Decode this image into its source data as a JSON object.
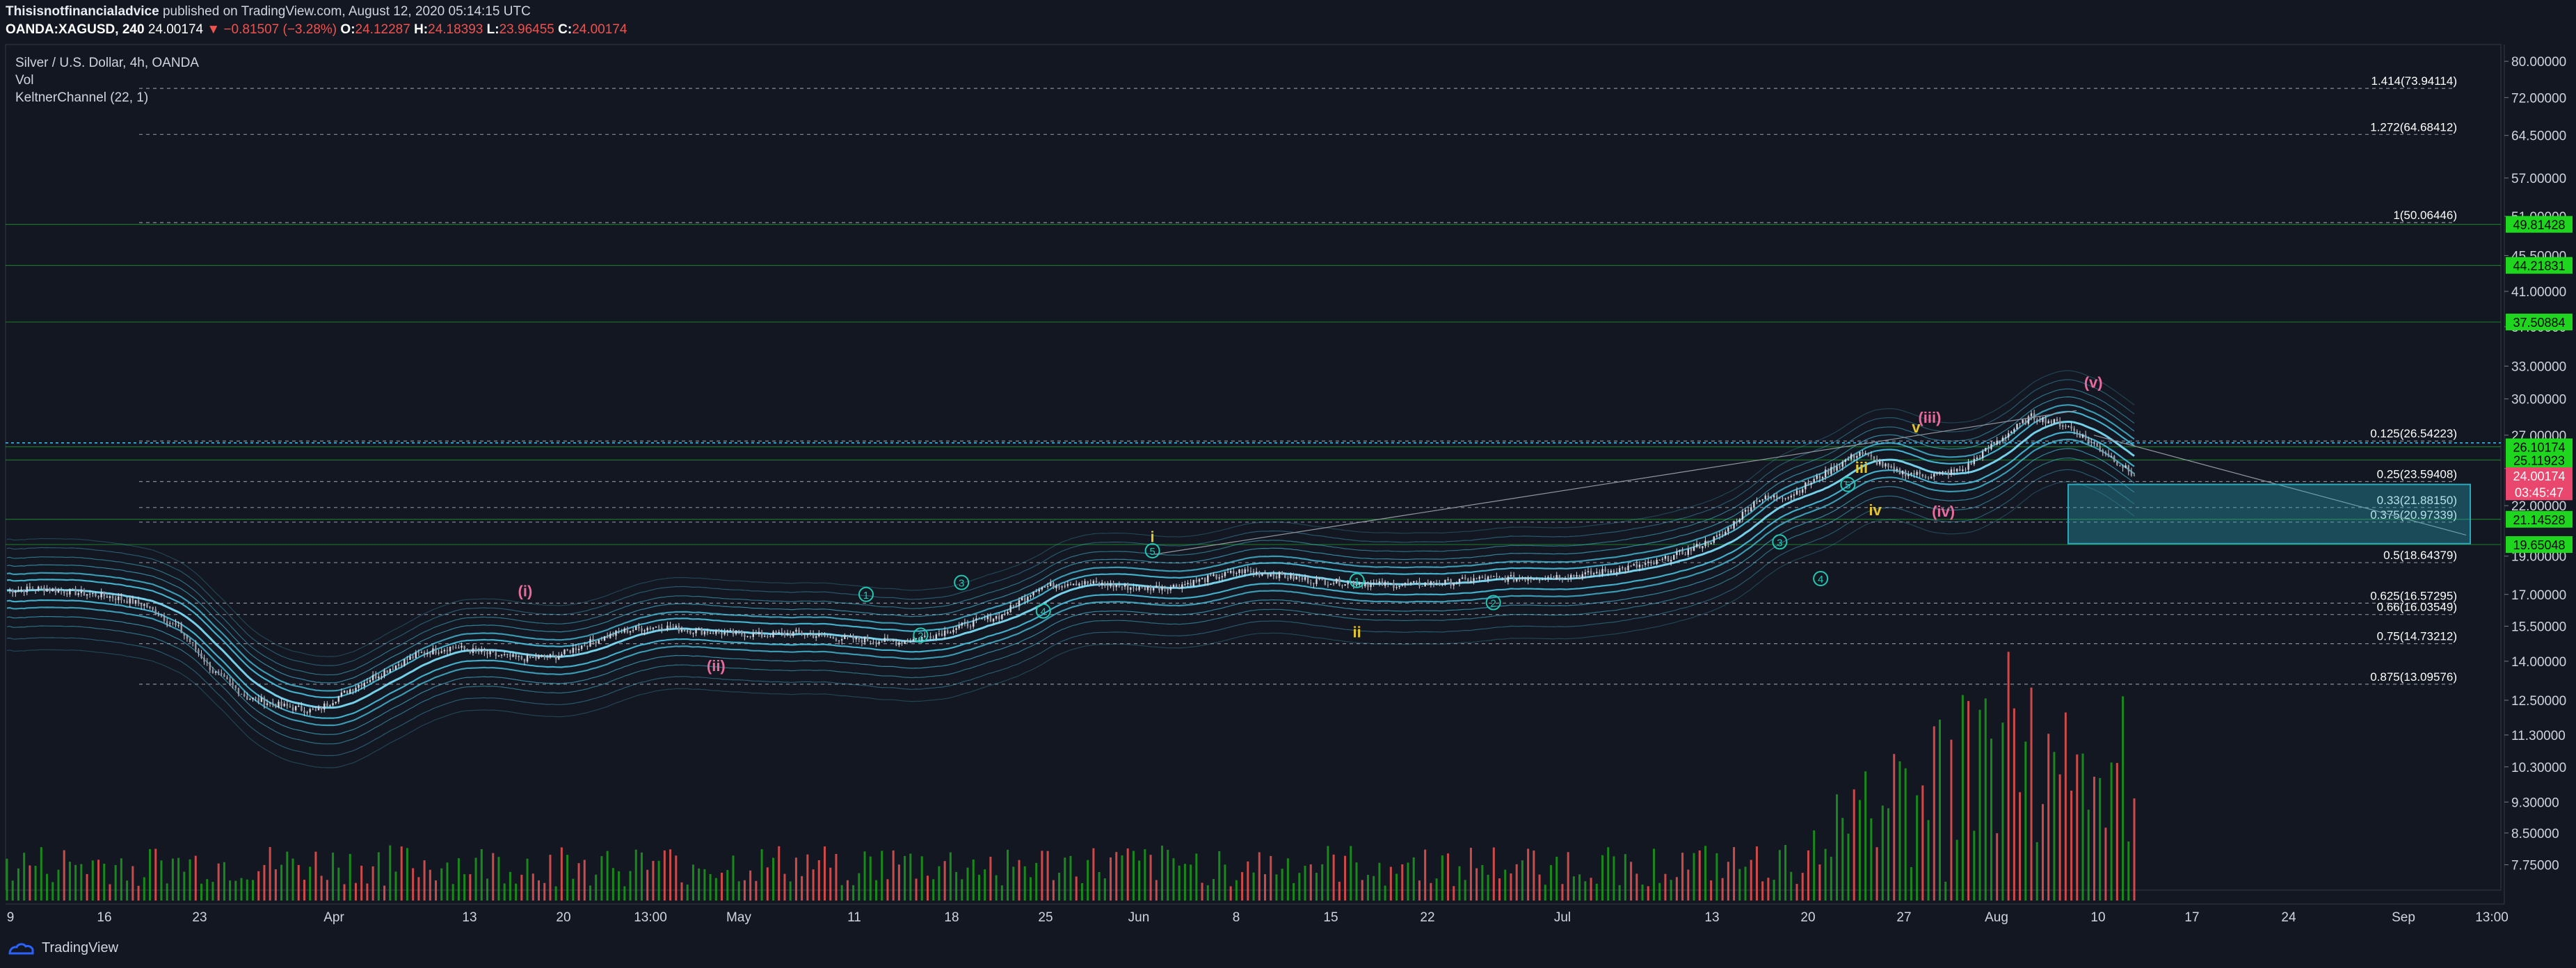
{
  "header": {
    "author": "Thisisnotfinancialadvice",
    "published": "published on TradingView.com, August 12, 2020 05:14:15 UTC",
    "symbol": "OANDA:XAGUSD, 240",
    "last": "24.00174",
    "change": "−0.81507 (−3.28%)",
    "o_label": "O:",
    "o_value": "24.12287",
    "h_label": "H:",
    "h_value": "24.18393",
    "l_label": "L:",
    "l_value": "23.96455",
    "c_label": "C:",
    "c_value": "24.00174"
  },
  "legend": {
    "title": "Silver / U.S. Dollar, 4h, OANDA",
    "vol": "Vol",
    "indicator": "KeltnerChannel (22, 1)"
  },
  "footer": {
    "brand": "TradingView"
  },
  "chart_data": {
    "type": "line",
    "title": "Silver / U.S. Dollar, 4h, OANDA",
    "y_scale": "log",
    "ylim": [
      7.2,
      84
    ],
    "y_ticks": [
      "80.00000",
      "72.00000",
      "64.50000",
      "57.00000",
      "51.00000",
      "45.50000",
      "41.00000",
      "37.00000",
      "33.00000",
      "30.00000",
      "27.00000",
      "24.50000",
      "22.00000",
      "19.00000",
      "17.00000",
      "15.50000",
      "14.00000",
      "12.50000",
      "11.30000",
      "10.30000",
      "9.30000",
      "8.50000",
      "7.75000"
    ],
    "x_ticks": [
      "9",
      "16",
      "23",
      "Apr",
      "13",
      "20",
      "13:00",
      "May",
      "11",
      "18",
      "25",
      "Jun",
      "8",
      "15",
      "22",
      "Jul",
      "13",
      "20",
      "27",
      "Aug",
      "10",
      "17",
      "24",
      "Sep",
      "13:00"
    ],
    "price_close": [
      17.2,
      17.3,
      17.1,
      16.9,
      16.5,
      15.4,
      13.6,
      12.6,
      12.3,
      12.1,
      12.9,
      13.6,
      14.3,
      14.6,
      14.3,
      14.1,
      14.2,
      14.8,
      15.3,
      15.5,
      15.3,
      15.2,
      15.1,
      15.2,
      15.0,
      14.9,
      14.8,
      15.1,
      15.6,
      16.0,
      17.3,
      17.6,
      17.5,
      17.3,
      17.4,
      17.8,
      18.2,
      18.0,
      17.7,
      17.6,
      17.5,
      17.5,
      17.6,
      17.8,
      17.8,
      17.9,
      18.0,
      18.3,
      18.6,
      19.3,
      20.2,
      22.4,
      22.7,
      24.2,
      25.7,
      24.3,
      24.0,
      24.4,
      26.5,
      28.5,
      27.8,
      26.0,
      24.0
    ],
    "price_series_start": "Mar 9",
    "price_series_end": "Aug 12",
    "last_price": "24.00174",
    "countdown": "03:45:47",
    "price_labels": [
      {
        "value": "49.81428",
        "color": "#1ed61e"
      },
      {
        "value": "44.21831",
        "color": "#1ed61e"
      },
      {
        "value": "37.50884",
        "color": "#1ed61e"
      },
      {
        "value": "26.10174",
        "color": "#1ed61e"
      },
      {
        "value": "25.11923",
        "color": "#1ed61e"
      },
      {
        "value": "24.00174",
        "color": "#e9476d"
      },
      {
        "value": "03:45:47",
        "color": "#e9476d"
      },
      {
        "value": "21.14528",
        "color": "#1ed61e"
      },
      {
        "value": "19.65048",
        "color": "#1ed61e"
      }
    ],
    "fib_levels": [
      {
        "label": "1.414(73.94114)",
        "price": 73.94114
      },
      {
        "label": "1.272(64.68412)",
        "price": 64.68412
      },
      {
        "label": "1(50.06446)",
        "price": 50.06446
      },
      {
        "label": "0.125(26.54223)",
        "price": 26.54223
      },
      {
        "label": "0.25(23.59408)",
        "price": 23.59408
      },
      {
        "label": "0.33(21.88150)",
        "price": 21.8815
      },
      {
        "label": "0.375(20.97339)",
        "price": 20.97339
      },
      {
        "label": "0.5(18.64379)",
        "price": 18.64379
      },
      {
        "label": "0.625(16.57295)",
        "price": 16.57295
      },
      {
        "label": "0.66(16.03549)",
        "price": 16.03549
      },
      {
        "label": "0.75(14.73212)",
        "price": 14.73212
      },
      {
        "label": "0.875(13.09576)",
        "price": 13.09576
      }
    ],
    "horizontal_lines": [
      49.81428,
      44.21831,
      37.50884,
      26.10174,
      25.11923,
      21.14528,
      19.65048
    ],
    "wave_labels": [
      {
        "text": "(i)",
        "color": "#e86b9b",
        "date": "Apr 16"
      },
      {
        "text": "(ii)",
        "color": "#e86b9b",
        "date": "Apr 30"
      },
      {
        "text": "i",
        "color": "#e6c52a",
        "date": "Jun 1"
      },
      {
        "text": "ii",
        "color": "#e6c52a",
        "date": "Jun 16"
      },
      {
        "text": "iii",
        "color": "#e6c52a",
        "date": "Jul 23"
      },
      {
        "text": "iv",
        "color": "#e6c52a",
        "date": "Jul 24"
      },
      {
        "text": "v",
        "color": "#e6c52a",
        "date": "Jul 27"
      },
      {
        "text": "(iii)",
        "color": "#e86b9b",
        "date": "Jul 28"
      },
      {
        "text": "(iv)",
        "color": "#e86b9b",
        "date": "Jul 29"
      },
      {
        "text": "(v)",
        "color": "#e86b9b",
        "date": "Aug 9"
      },
      {
        "text": "1",
        "color": "#22c7b2",
        "date": "May 11"
      },
      {
        "text": "2",
        "color": "#22c7b2",
        "date": "May 15"
      },
      {
        "text": "3",
        "color": "#22c7b2",
        "date": "May 18"
      },
      {
        "text": "4",
        "color": "#22c7b2",
        "date": "May 24"
      },
      {
        "text": "5",
        "color": "#22c7b2",
        "date": "Jun 1"
      },
      {
        "text": "1",
        "color": "#22c7b2",
        "date": "Jun 16"
      },
      {
        "text": "2",
        "color": "#22c7b2",
        "date": "Jun 26"
      },
      {
        "text": "3",
        "color": "#22c7b2",
        "date": "Jul 17"
      },
      {
        "text": "4",
        "color": "#22c7b2",
        "date": "Jul 20"
      },
      {
        "text": "5",
        "color": "#22c7b2",
        "date": "Jul 22"
      }
    ],
    "colors": {
      "background": "#131722",
      "candle": "#d1d4dc",
      "volume_up": "#26a69a",
      "volume_green": "#1b9e1b",
      "volume_red": "#ef5350",
      "keltner": "#4cc9e8",
      "target_box": "#2aa9be",
      "fib_line": "#b2b5be",
      "last_price": "#e9476d"
    }
  }
}
